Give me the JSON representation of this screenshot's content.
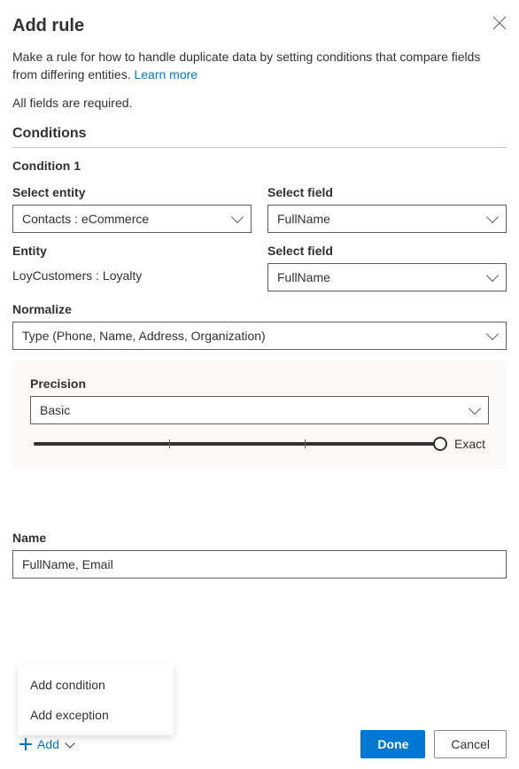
{
  "header": {
    "title": "Add rule"
  },
  "description": {
    "text": "Make a rule for how to handle duplicate data by setting conditions that compare fields from differing entities. ",
    "link": "Learn more"
  },
  "required_text": "All fields are required.",
  "conditions": {
    "heading": "Conditions",
    "condition_label": "Condition 1",
    "entity1": {
      "label": "Select entity",
      "value": "Contacts : eCommerce"
    },
    "field1": {
      "label": "Select field",
      "value": "FullName"
    },
    "entity2": {
      "label": "Entity",
      "value": "LoyCustomers : Loyalty"
    },
    "field2": {
      "label": "Select field",
      "value": "FullName"
    },
    "normalize": {
      "label": "Normalize",
      "value": "Type (Phone, Name, Address, Organization)"
    },
    "precision": {
      "label": "Precision",
      "value": "Basic",
      "slider_end": "Exact"
    }
  },
  "name": {
    "label": "Name",
    "value": "FullName, Email"
  },
  "popup": {
    "add_condition": "Add condition",
    "add_exception": "Add exception"
  },
  "footer": {
    "add_label": "Add",
    "done_label": "Done",
    "cancel_label": "Cancel"
  }
}
